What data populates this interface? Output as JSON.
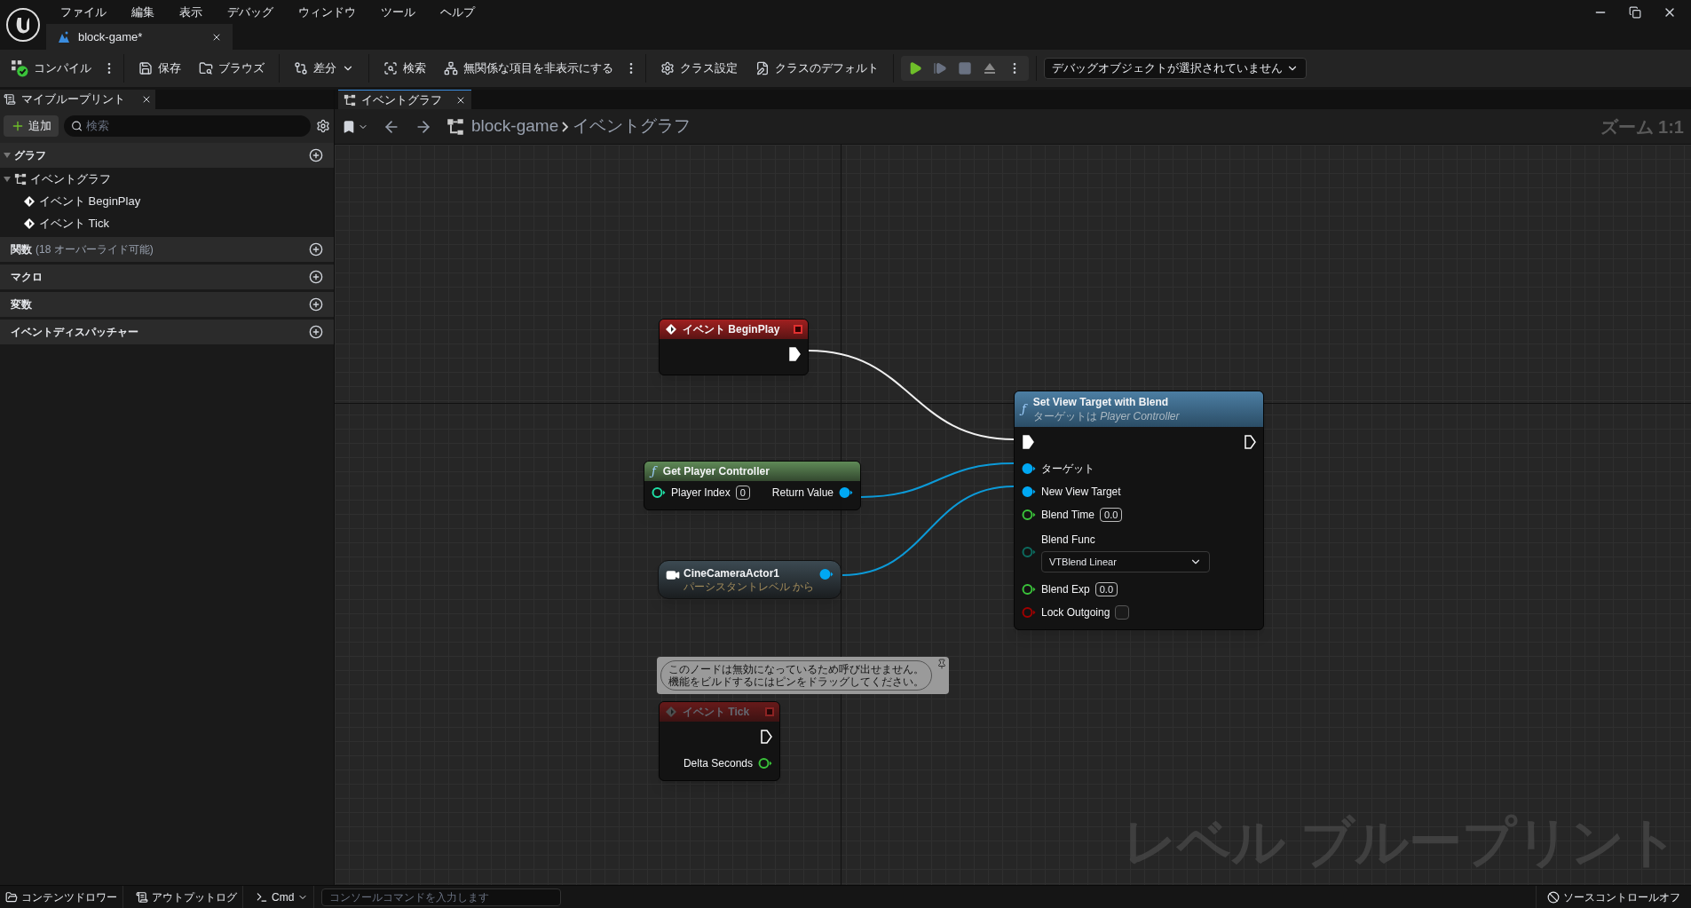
{
  "menu": [
    "ファイル",
    "編集",
    "表示",
    "デバッグ",
    "ウィンドウ",
    "ツール",
    "ヘルプ"
  ],
  "document_tabs": [
    {
      "label": "block-game*",
      "selected": true
    }
  ],
  "toolbar": {
    "groups": [
      [
        {
          "kind": "button",
          "label": "コンパイル"
        },
        {
          "kind": "more"
        }
      ],
      [
        {
          "kind": "button",
          "label": "保存"
        },
        {
          "kind": "button",
          "label": "ブラウズ"
        }
      ],
      [
        {
          "kind": "dropdown",
          "label": "差分"
        }
      ],
      [
        {
          "kind": "button",
          "label": "検索"
        },
        {
          "kind": "button",
          "label": "無関係な項目を非表示にする"
        },
        {
          "kind": "more"
        }
      ],
      [
        {
          "kind": "button",
          "label": "クラス設定"
        },
        {
          "kind": "button",
          "label": "クラスのデフォルト"
        }
      ],
      [
        {
          "kind": "play_controls"
        }
      ],
      [
        {
          "kind": "select",
          "label": "デバッグオブジェクトが選択されていません"
        }
      ]
    ]
  },
  "my_blueprint": {
    "tab": {
      "label": "マイブループリント"
    },
    "add_button": "追加",
    "search": {
      "placeholder": "検索"
    },
    "sections": [
      {
        "label": "グラフ",
        "children": [
          {
            "label": "イベントグラフ",
            "kind": "graph",
            "children": [
              {
                "label": "イベント BeginPlay",
                "kind": "event"
              },
              {
                "label": "イベント Tick",
                "kind": "event"
              }
            ]
          }
        ]
      },
      {
        "label": "関数",
        "note": "(18 オーバーライド可能)"
      },
      {
        "label": "マクロ"
      },
      {
        "label": "変数"
      },
      {
        "label": "イベントディスパッチャー"
      }
    ]
  },
  "graph_tabs": [
    {
      "label": "イベントグラフ",
      "selected": true
    }
  ],
  "breadcrumb": [
    "block-game",
    "イベントグラフ"
  ],
  "zoom_label": "ズーム 1:1",
  "graph_watermark": "レベル ブループリント",
  "nodes": [
    {
      "kind": "event",
      "title": "イベント BeginPlay",
      "disabled": false,
      "outputs": [
        {
          "kind": "exec",
          "connected": true
        }
      ]
    },
    {
      "kind": "function",
      "icon": "ƒ",
      "title": "Set View Target with Blend",
      "subtitle": "ターゲットは *Player Controller*",
      "disabled": false,
      "inputs": [
        {
          "kind": "exec",
          "connected": true
        },
        {
          "kind": "object",
          "label": "ターゲット",
          "connected": true
        },
        {
          "kind": "object",
          "label": "New View Target",
          "connected": true
        },
        {
          "kind": "float",
          "label": "Blend Time",
          "value": "0.0",
          "connected": false
        },
        {
          "kind": "enum",
          "label": "Blend Func",
          "value": "VTBlend Linear",
          "connected": false
        },
        {
          "kind": "float",
          "label": "Blend Exp",
          "value": "0.0",
          "connected": false
        },
        {
          "kind": "bool",
          "label": "Lock Outgoing",
          "checked": false,
          "connected": false
        }
      ],
      "outputs": [
        {
          "kind": "exec",
          "connected": false
        }
      ]
    },
    {
      "kind": "pure_function",
      "icon": "ƒ",
      "title": "Get Player Controller",
      "disabled": false,
      "inputs": [
        {
          "kind": "int",
          "label": "Player Index",
          "value": "0",
          "connected": false
        }
      ],
      "outputs": [
        {
          "kind": "object",
          "label": "Return Value",
          "connected": true
        }
      ]
    },
    {
      "kind": "actor_ref",
      "title": "CineCameraActor1",
      "subtitle": "パーシスタントレベル から",
      "disabled": false,
      "outputs": [
        {
          "kind": "object",
          "connected": true
        }
      ]
    },
    {
      "kind": "event",
      "title": "イベント Tick",
      "disabled": true,
      "comment": "このノードは無効になっているため呼び出せません。機能をビルドするにはピンをドラッグしてください。",
      "outputs": [
        {
          "kind": "exec",
          "connected": false
        },
        {
          "kind": "float",
          "label": "Delta Seconds",
          "connected": false
        }
      ]
    }
  ],
  "bottom_bar": {
    "items": [
      {
        "kind": "button",
        "label": "コンテンツドロワー"
      },
      {
        "kind": "button",
        "label": "アウトプットログ"
      },
      {
        "kind": "dropdown",
        "label": "Cmd"
      },
      {
        "kind": "field",
        "placeholder": "コンソールコマンドを入力します"
      }
    ],
    "source_control": "ソースコントロールオフ"
  }
}
